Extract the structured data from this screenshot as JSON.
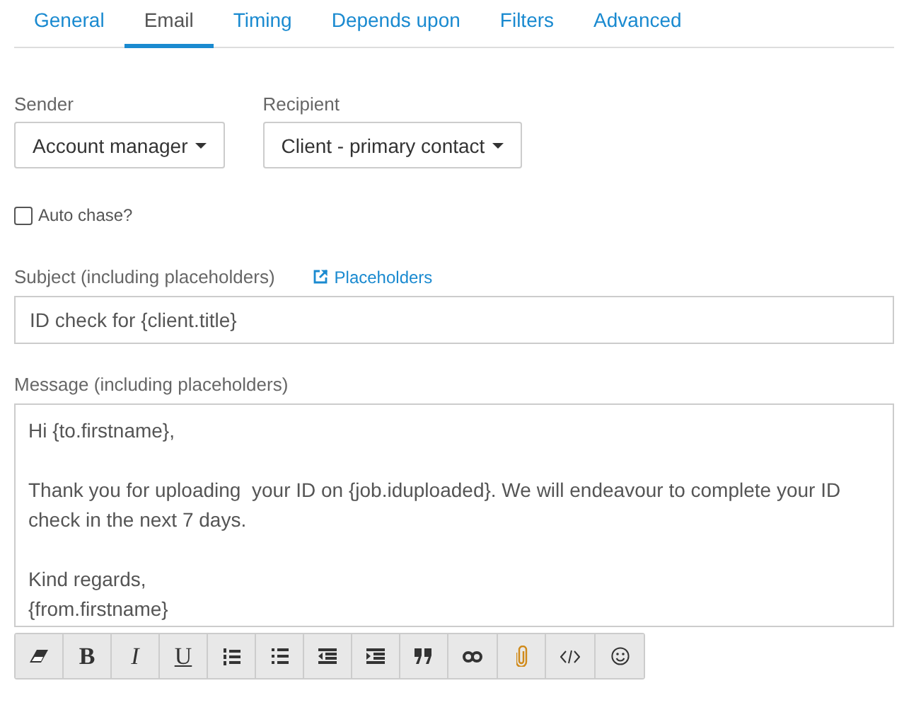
{
  "tabs": [
    {
      "label": "General",
      "selected": false
    },
    {
      "label": "Email",
      "selected": true
    },
    {
      "label": "Timing",
      "selected": false
    },
    {
      "label": "Depends upon",
      "selected": false
    },
    {
      "label": "Filters",
      "selected": false
    },
    {
      "label": "Advanced",
      "selected": false
    }
  ],
  "sender": {
    "label": "Sender",
    "value": "Account manager"
  },
  "recipient": {
    "label": "Recipient",
    "value": "Client - primary contact"
  },
  "auto_chase": {
    "label": "Auto chase?",
    "checked": false
  },
  "subject": {
    "label": "Subject (including placeholders)",
    "link": "Placeholders",
    "value": "ID check for {client.title}"
  },
  "message": {
    "label": "Message (including placeholders)",
    "paragraphs": [
      [
        "Hi {to.firstname},"
      ],
      [
        "Thank you for uploading  your ID on {job.iduploaded}. We will endeavour to complete your ID check in the next 7 days."
      ],
      [
        "Kind regards,",
        "{from.firstname}"
      ]
    ]
  },
  "toolbar": [
    {
      "kind": "eraser"
    },
    {
      "kind": "bold",
      "label": "B"
    },
    {
      "kind": "italic",
      "label": "I"
    },
    {
      "kind": "underline",
      "label": "U"
    },
    {
      "kind": "ol"
    },
    {
      "kind": "ul"
    },
    {
      "kind": "outdent"
    },
    {
      "kind": "indent"
    },
    {
      "kind": "quote"
    },
    {
      "kind": "link"
    },
    {
      "kind": "attach"
    },
    {
      "kind": "code"
    },
    {
      "kind": "emoji"
    }
  ]
}
